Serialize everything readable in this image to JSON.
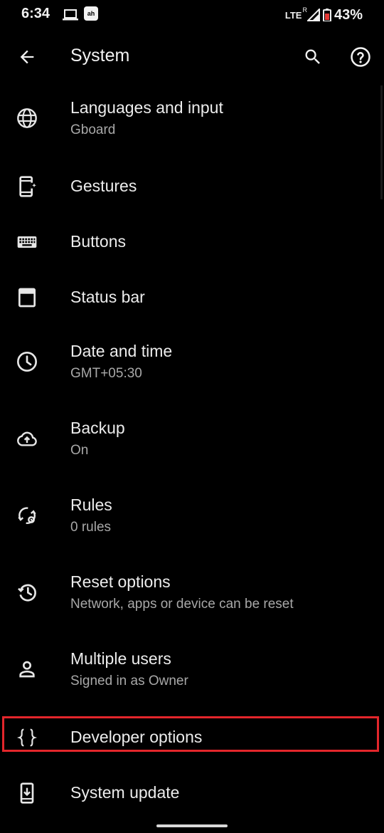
{
  "status_bar": {
    "time": "6:34",
    "app_badge": "ah",
    "network": "LTE",
    "roaming": "R",
    "battery": "43%",
    "icons": [
      "laptop-icon",
      "app-notification-icon",
      "signal-icon",
      "battery-icon"
    ]
  },
  "toolbar": {
    "title": "System",
    "icons": [
      "back-arrow-icon",
      "search-icon",
      "help-icon"
    ]
  },
  "items": [
    {
      "title": "Languages and input",
      "subtitle": "Gboard",
      "icon": "globe-icon"
    },
    {
      "title": "Gestures",
      "icon": "gestures-phone-icon"
    },
    {
      "title": "Buttons",
      "icon": "keyboard-icon"
    },
    {
      "title": "Status bar",
      "icon": "status-bar-icon"
    },
    {
      "title": "Date and time",
      "subtitle": "GMT+05:30",
      "icon": "clock-icon"
    },
    {
      "title": "Backup",
      "subtitle": "On",
      "icon": "cloud-upload-icon"
    },
    {
      "title": "Rules",
      "subtitle": "0 rules",
      "icon": "rules-icon"
    },
    {
      "title": "Reset options",
      "subtitle": "Network, apps or device can be reset",
      "icon": "restore-icon"
    },
    {
      "title": "Multiple users",
      "subtitle": "Signed in as Owner",
      "icon": "person-icon"
    },
    {
      "title": "Developer options",
      "icon": "braces-icon"
    },
    {
      "title": "System update",
      "icon": "system-update-icon"
    }
  ],
  "colors": {
    "background": "#000000",
    "text": "#ececec",
    "subtext": "#a8a8a8",
    "highlight": "#e3262b",
    "battery_low": "#e53935"
  }
}
